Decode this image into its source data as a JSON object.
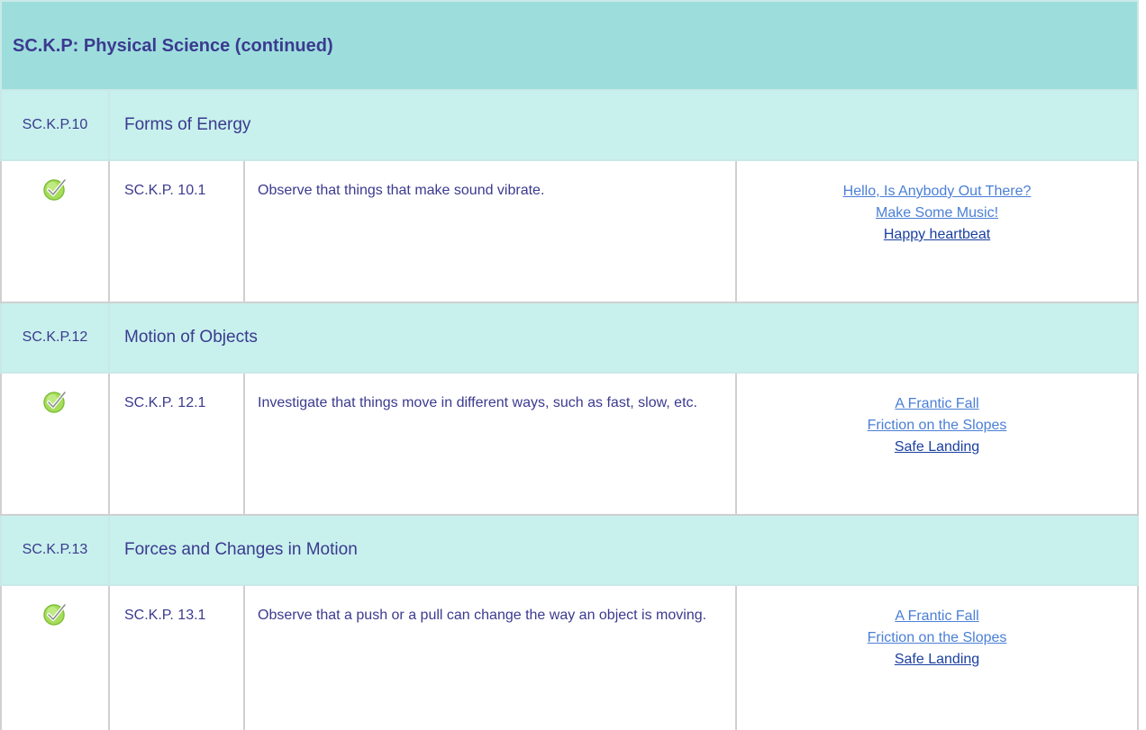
{
  "title": "SC.K.P: Physical Science (continued)",
  "sections": [
    {
      "code": "SC.K.P.10",
      "name": "Forms of Energy",
      "item": {
        "code": "SC.K.P. 10.1",
        "description": "Observe that things that make sound vibrate.",
        "links": [
          "Hello, Is Anybody Out There?",
          "Make Some Music!",
          "Happy heartbeat"
        ]
      }
    },
    {
      "code": "SC.K.P.12",
      "name": "Motion of Objects",
      "item": {
        "code": "SC.K.P. 12.1",
        "description": "Investigate that things move in different ways, such as fast, slow, etc.",
        "links": [
          "A Frantic Fall",
          "Friction on the Slopes",
          "Safe Landing"
        ]
      }
    },
    {
      "code": "SC.K.P.13",
      "name": "Forces and Changes in Motion",
      "item": {
        "code": "SC.K.P. 13.1",
        "description": "Observe that a push or a pull can change the way an object is moving.",
        "links": [
          "A Frantic Fall",
          "Friction on the Slopes",
          "Safe Landing"
        ]
      }
    }
  ],
  "icons": {
    "check": "check-icon"
  },
  "colors": {
    "title_bg": "#9ddedd",
    "section_bg": "#c8f1ed",
    "text": "#3b3a8f",
    "link": "#4a7fd6",
    "link_visited_dark": "#1a3fa0",
    "check_green": "#8fd13f"
  }
}
